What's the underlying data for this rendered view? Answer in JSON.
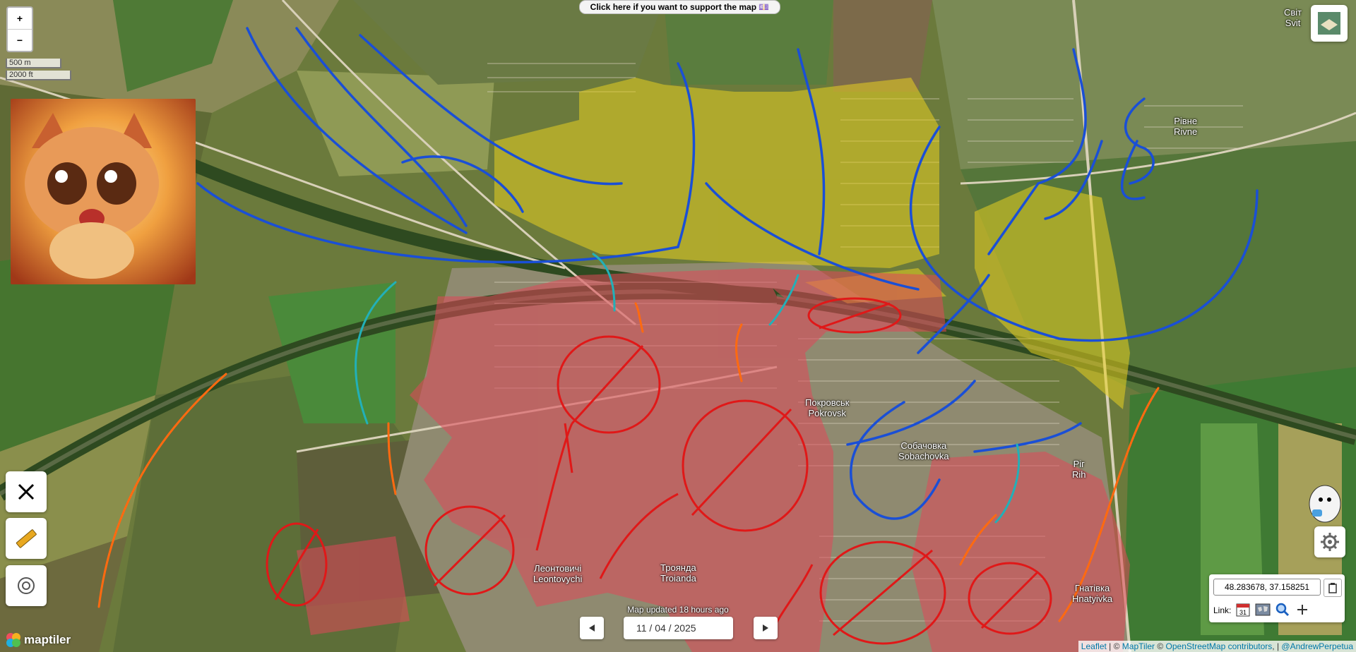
{
  "map": {
    "support_banner": "Click here if you want to support the map 💷",
    "zoom_in": "+",
    "zoom_out": "−",
    "scale_metric": "500 m",
    "scale_imperial": "2000 ft",
    "places": {
      "pokrovsk_local": "Покровськ",
      "pokrovsk": "Pokrovsk",
      "sobachovka_local": "Собачовка",
      "sobachovka": "Sobachovka",
      "rih_local": "Рiг",
      "rih": "Rih",
      "leontovychi_local": "Леонтовичi",
      "leontovychi": "Leontovychi",
      "troianda_local": "Троянда",
      "troianda": "Troianda",
      "hnativka_local": "Гнатiвка",
      "hnativka": "Hnatyivka",
      "rivne_local": "Рiвне",
      "rivne": "Rivne",
      "svit_local": "Світ",
      "svit": "Svit"
    },
    "updated_text": "Map updated 18 hours ago",
    "date_value": "11 / 04 / 2025",
    "coordinates": "48.283678, 37.158251",
    "link_label": "Link:",
    "calendar_day": "31",
    "maptiler_logo": "maptiler",
    "attribution": {
      "leaflet": "Leaflet",
      "sep1": " | © ",
      "maptiler": "MapTiler",
      "sep2": " © ",
      "osm": "OpenStreetMap contributors",
      "sep3": ", | ",
      "author": "@AndrewPerpetua"
    }
  },
  "colors": {
    "red_zone": "#e0485a",
    "yellow_zone": "#e8d020",
    "blue_arrow": "#1a4fd6",
    "red_arrow": "#e01818",
    "orange_arrow": "#ff6a10",
    "teal_arrow": "#22b0b8"
  },
  "icons": [
    "x-logo-icon",
    "ruler-icon",
    "target-icon",
    "layers-icon",
    "gear-icon",
    "copy-icon",
    "calendar-icon",
    "world-map-icon",
    "search-icon",
    "plus-icon",
    "prev-arrow-icon",
    "next-arrow-icon"
  ]
}
